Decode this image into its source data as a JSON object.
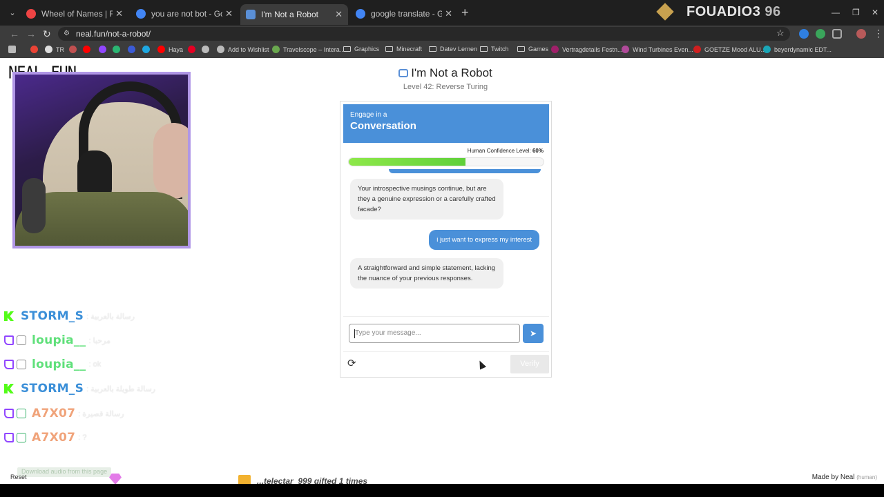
{
  "browser": {
    "tabs": [
      {
        "title": "Wheel of Names | Random nam",
        "icon_color": "#e44"
      },
      {
        "title": "you are not bot - Google Search",
        "icon_color": "#4285f4"
      },
      {
        "title": "I'm Not a Robot",
        "icon_color": "#5a8fd6",
        "active": true
      },
      {
        "title": "google translate - Google Sear",
        "icon_color": "#4285f4"
      }
    ],
    "new_tab": "+",
    "url": "neal.fun/not-a-robot/",
    "bookmarks": [
      {
        "label": "",
        "icon": "apps-icon",
        "color": "#bbbbbb"
      },
      {
        "label": "",
        "icon": "gmail-icon",
        "color": "#ea4335"
      },
      {
        "label": "TR",
        "icon": "chrome-icon",
        "color": "#dddddd"
      },
      {
        "label": "",
        "icon": "app-icon",
        "color": "#c05050"
      },
      {
        "label": "",
        "icon": "youtube-icon",
        "color": "#ff0000"
      },
      {
        "label": "",
        "icon": "twitch-icon",
        "color": "#9146ff"
      },
      {
        "label": "",
        "icon": "app-icon",
        "color": "#2bb673"
      },
      {
        "label": "",
        "icon": "app-icon",
        "color": "#3b5bd6"
      },
      {
        "label": "",
        "icon": "app-icon",
        "color": "#1ea7e1"
      },
      {
        "label": "Haya",
        "icon": "youtube-icon",
        "color": "#ff0000"
      },
      {
        "label": "",
        "icon": "pinterest-icon",
        "color": "#e60023"
      },
      {
        "label": "",
        "icon": "app-icon",
        "color": "#bbbbbb"
      },
      {
        "label": "Add to Wishlist",
        "icon": "globe-icon",
        "color": "#bbbbbb"
      },
      {
        "label": "Travelscope – Intera...",
        "icon": "app-icon",
        "color": "#6aa84f"
      },
      {
        "label": "Graphics",
        "icon": "folder-icon",
        "color": ""
      },
      {
        "label": "Minecraft",
        "icon": "folder-icon",
        "color": ""
      },
      {
        "label": "Datev Lernen",
        "icon": "folder-icon",
        "color": ""
      },
      {
        "label": "Twitch",
        "icon": "folder-icon",
        "color": ""
      },
      {
        "label": "Games",
        "icon": "folder-icon",
        "color": ""
      },
      {
        "label": "Vertragdetails Festn...",
        "icon": "app-icon",
        "color": "#a0206a"
      },
      {
        "label": "Wind Turbines Even...",
        "icon": "app-icon",
        "color": "#b04a9a"
      },
      {
        "label": "GOETZE Mood ALU...",
        "icon": "app-icon",
        "color": "#d01f1f"
      },
      {
        "label": "beyerdynamic EDT...",
        "icon": "app-icon",
        "color": "#1aa6b7"
      }
    ]
  },
  "stream": {
    "brand": "FOUADIO3",
    "brand_count": "96",
    "chat": [
      {
        "platform": "kick",
        "user": "STORM_S",
        "color": "#3b8fd8",
        "message": ": رسالة بالعربية"
      },
      {
        "platform": "twitch",
        "user": "loupia__",
        "color": "#5fe07a",
        "message": ": مرحبا"
      },
      {
        "platform": "twitch",
        "user": "loupia__",
        "color": "#5fe07a",
        "message": ": ok"
      },
      {
        "platform": "kick",
        "user": "STORM_S",
        "color": "#3b8fd8",
        "message": ": رسالة طويلة بالعربية"
      },
      {
        "platform": "twitch",
        "user": "A7X07",
        "color": "#f0a37a",
        "message": ": رسالة قصيرة"
      },
      {
        "platform": "twitch",
        "user": "A7X07",
        "color": "#f0a37a",
        "message": ": ?"
      }
    ],
    "download_audio": "Download audio from this page",
    "gift_text": "...telectar_999 gifted 1 times"
  },
  "site": {
    "logo": "NEAL.FUN",
    "title": "I'm Not a Robot",
    "subtitle": "Level 42: Reverse Turing",
    "card": {
      "head_small": "Engage in a",
      "head_big": "Conversation",
      "confidence_label": "Human Confidence Level:",
      "confidence_value": "60%",
      "confidence_fraction": 0.6,
      "messages": [
        {
          "from": "bot",
          "text": "Your introspective musings continue, but are they a genuine expression or a carefully crafted facade?"
        },
        {
          "from": "user",
          "text": "i just want to express my interest"
        },
        {
          "from": "bot",
          "text": "A straightforward and simple statement, lacking the nuance of your previous responses."
        }
      ],
      "input_placeholder": "Type your message...",
      "verify": "Verify"
    },
    "reset": "Reset",
    "made_by": "Made by Neal",
    "made_by_note": "(human)"
  }
}
